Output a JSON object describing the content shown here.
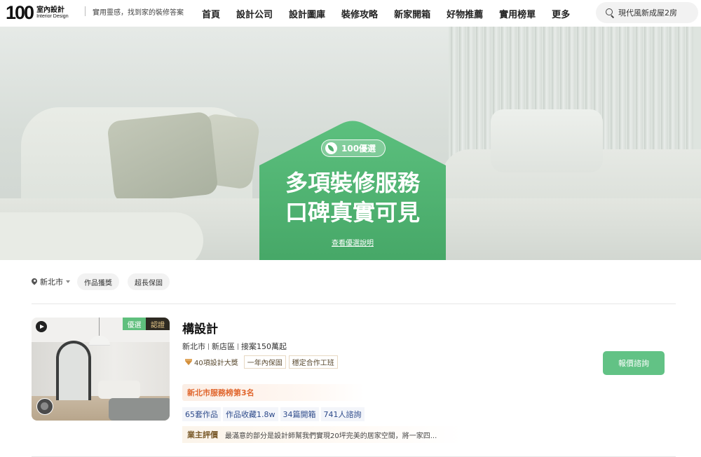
{
  "header": {
    "logo_number": "100",
    "logo_cn": "室內設計",
    "logo_en": "Interior Design",
    "tagline": "實用靈感，找到家的裝修答案",
    "nav": [
      "首頁",
      "設計公司",
      "設計圖庫",
      "裝修攻略",
      "新家開箱",
      "好物推薦",
      "實用榜單",
      "更多"
    ],
    "search_text": "現代風新成屋2房"
  },
  "hero": {
    "badge": "100優選",
    "title_line1": "多項裝修服務",
    "title_line2": "口碑真實可見",
    "link": "查看優選說明",
    "accent_color": "#4eae6e"
  },
  "filters": {
    "location": "新北市",
    "chips": [
      "作品獲獎",
      "超長保固"
    ]
  },
  "card": {
    "tag_youxuan": "優選",
    "tag_renzheng": "認證",
    "name": "構設計",
    "meta": [
      "新北市",
      "新店區",
      "接案150萬起"
    ],
    "feature_tags": [
      "40項設計大獎",
      "一年內保固",
      "穩定合作工班"
    ],
    "rank": "新北市服務榜第3名",
    "stats": [
      "65套作品",
      "作品收藏1.8w",
      "34篇開箱",
      "741人諮詢"
    ],
    "review_label": "業主評價",
    "review_text": "最滿意的部分是設計師幫我們實現20坪完美的居家空間，將一家四...",
    "quote_button": "報價諮詢",
    "button_color": "#62c285"
  },
  "icons": [
    "search-icon",
    "leaf-icon",
    "pin-icon",
    "caret-down-icon",
    "play-icon",
    "diamond-icon"
  ]
}
